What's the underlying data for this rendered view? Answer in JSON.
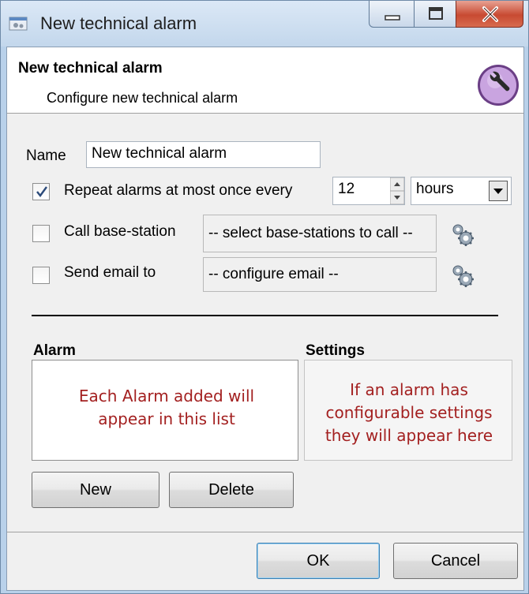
{
  "window": {
    "title": "New technical alarm",
    "controls": {
      "minimize": "minimize",
      "maximize": "maximize",
      "close": "close"
    }
  },
  "header": {
    "title": "New technical alarm",
    "subtitle": "Configure new technical alarm",
    "icon": "wrench-icon",
    "icon_color": "#c9a4e0"
  },
  "form": {
    "name_label": "Name",
    "name_value": "New technical alarm",
    "repeat": {
      "checked": true,
      "label": "Repeat alarms at most once every",
      "interval": "12",
      "unit": "hours"
    },
    "call": {
      "checked": false,
      "label": "Call base-station",
      "value": "-- select base-stations to call --",
      "icon": "gear-icon"
    },
    "email": {
      "checked": false,
      "label": "Send email to",
      "value": "-- configure email --",
      "icon": "gear-icon"
    }
  },
  "alarm": {
    "title": "Alarm",
    "note": "Each Alarm added will appear in this list",
    "new_label": "New",
    "delete_label": "Delete"
  },
  "settings": {
    "title": "Settings",
    "note": "If an alarm has configurable settings they will appear here"
  },
  "footer": {
    "ok_label": "OK",
    "cancel_label": "Cancel"
  },
  "colors": {
    "annotation": "#a32020",
    "close_button": "#c84a32",
    "default_button_border": "#3c7fb1"
  }
}
